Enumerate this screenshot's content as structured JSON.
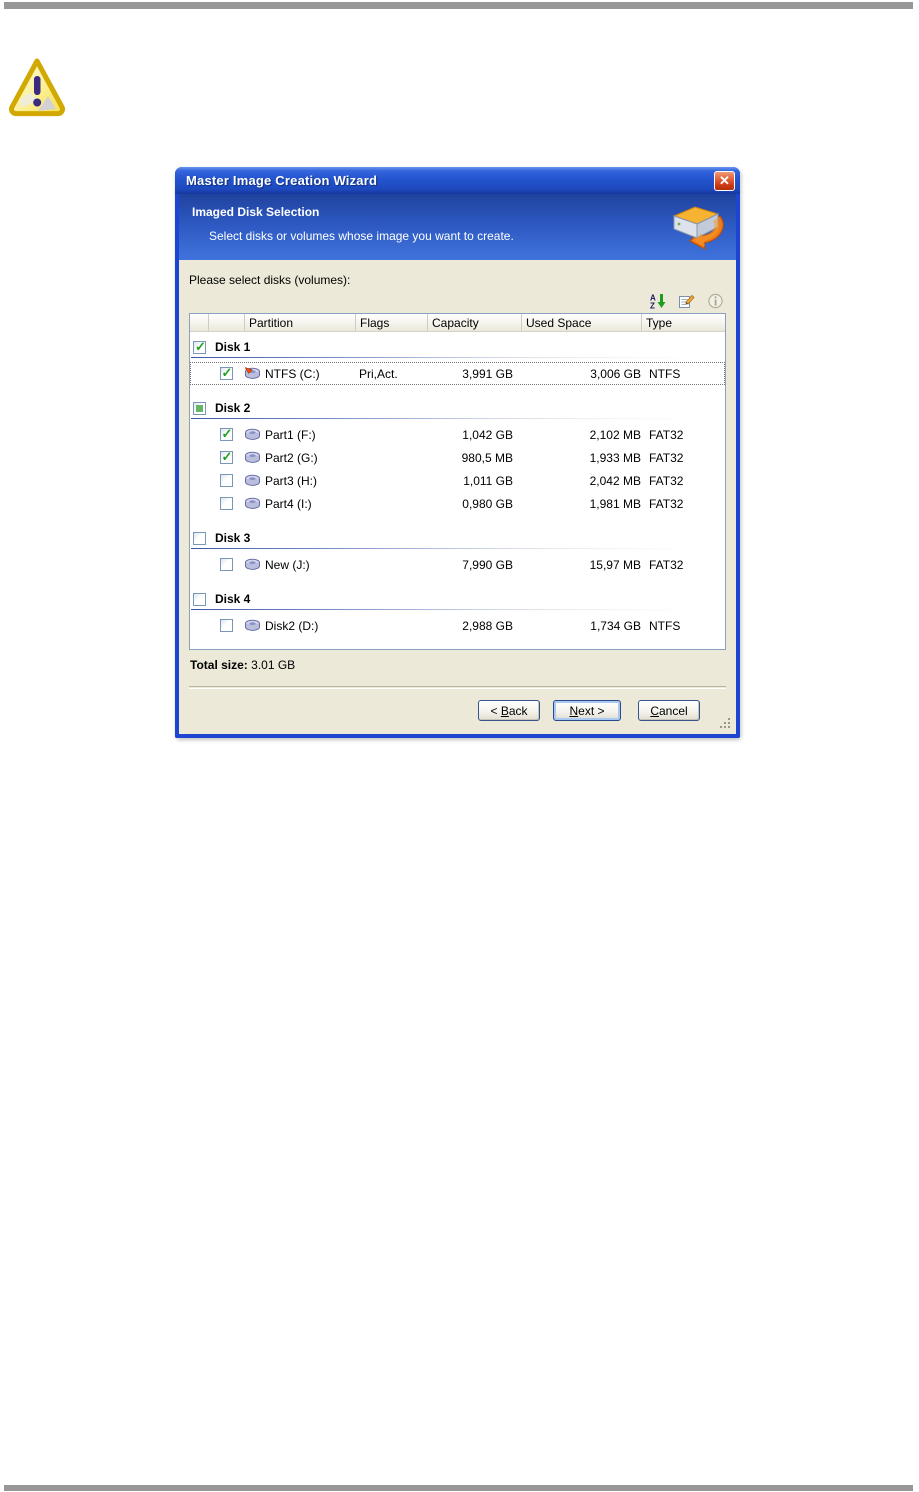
{
  "dialog": {
    "title": "Master Image Creation Wizard",
    "banner": {
      "title": "Imaged Disk Selection",
      "subtitle": "Select disks or volumes whose image you want to create."
    },
    "prompt": "Please select disks (volumes):",
    "toolbar": {
      "icons": [
        "sort-az",
        "properties",
        "info-disabled"
      ]
    },
    "table": {
      "columns": [
        "",
        "",
        "Partition",
        "Flags",
        "Capacity",
        "Used Space",
        "Type"
      ],
      "groups": [
        {
          "name": "Disk 1",
          "state": "checked",
          "rows": [
            {
              "name": "NTFS (C:)",
              "icon": "disk-active",
              "flags": "Pri,Act.",
              "capacity": "3,991 GB",
              "used": "3,006 GB",
              "type": "NTFS",
              "checked": true,
              "focused": true
            }
          ]
        },
        {
          "name": "Disk 2",
          "state": "indeterminate",
          "rows": [
            {
              "name": "Part1 (F:)",
              "icon": "disk",
              "flags": "",
              "capacity": "1,042 GB",
              "used": "2,102 MB",
              "type": "FAT32",
              "checked": true,
              "focused": false
            },
            {
              "name": "Part2 (G:)",
              "icon": "disk",
              "flags": "",
              "capacity": "980,5 MB",
              "used": "1,933 MB",
              "type": "FAT32",
              "checked": true,
              "focused": false
            },
            {
              "name": "Part3 (H:)",
              "icon": "disk",
              "flags": "",
              "capacity": "1,011 GB",
              "used": "2,042 MB",
              "type": "FAT32",
              "checked": false,
              "focused": false
            },
            {
              "name": "Part4 (I:)",
              "icon": "disk",
              "flags": "",
              "capacity": "0,980 GB",
              "used": "1,981 MB",
              "type": "FAT32",
              "checked": false,
              "focused": false
            }
          ]
        },
        {
          "name": "Disk 3",
          "state": "unchecked",
          "rows": [
            {
              "name": "New (J:)",
              "icon": "disk",
              "flags": "",
              "capacity": "7,990 GB",
              "used": "15,97 MB",
              "type": "FAT32",
              "checked": false,
              "focused": false
            }
          ]
        },
        {
          "name": "Disk 4",
          "state": "unchecked",
          "rows": [
            {
              "name": "Disk2 (D:)",
              "icon": "disk",
              "flags": "",
              "capacity": "2,988 GB",
              "used": "1,734 GB",
              "type": "NTFS",
              "checked": false,
              "focused": false
            }
          ]
        }
      ]
    },
    "total": {
      "label": "Total size:",
      "value": "3.01 GB"
    },
    "buttons": {
      "back": {
        "pre": "< ",
        "key": "B",
        "rest": "ack"
      },
      "next": {
        "pre": "",
        "key": "N",
        "rest": "ext >"
      },
      "cancel": {
        "pre": "",
        "key": "C",
        "rest": "ancel"
      }
    },
    "close_glyph": "✕"
  },
  "colors": {
    "titlebar_blue": "#2353cd",
    "frame_blue": "#1c45d1",
    "banner_top": "#20429e",
    "banner_bottom": "#4173dc",
    "client_face": "#ece9d8",
    "close_red": "#cc3912",
    "check_green": "#1ea11e",
    "page_bar_gray": "#979797"
  }
}
